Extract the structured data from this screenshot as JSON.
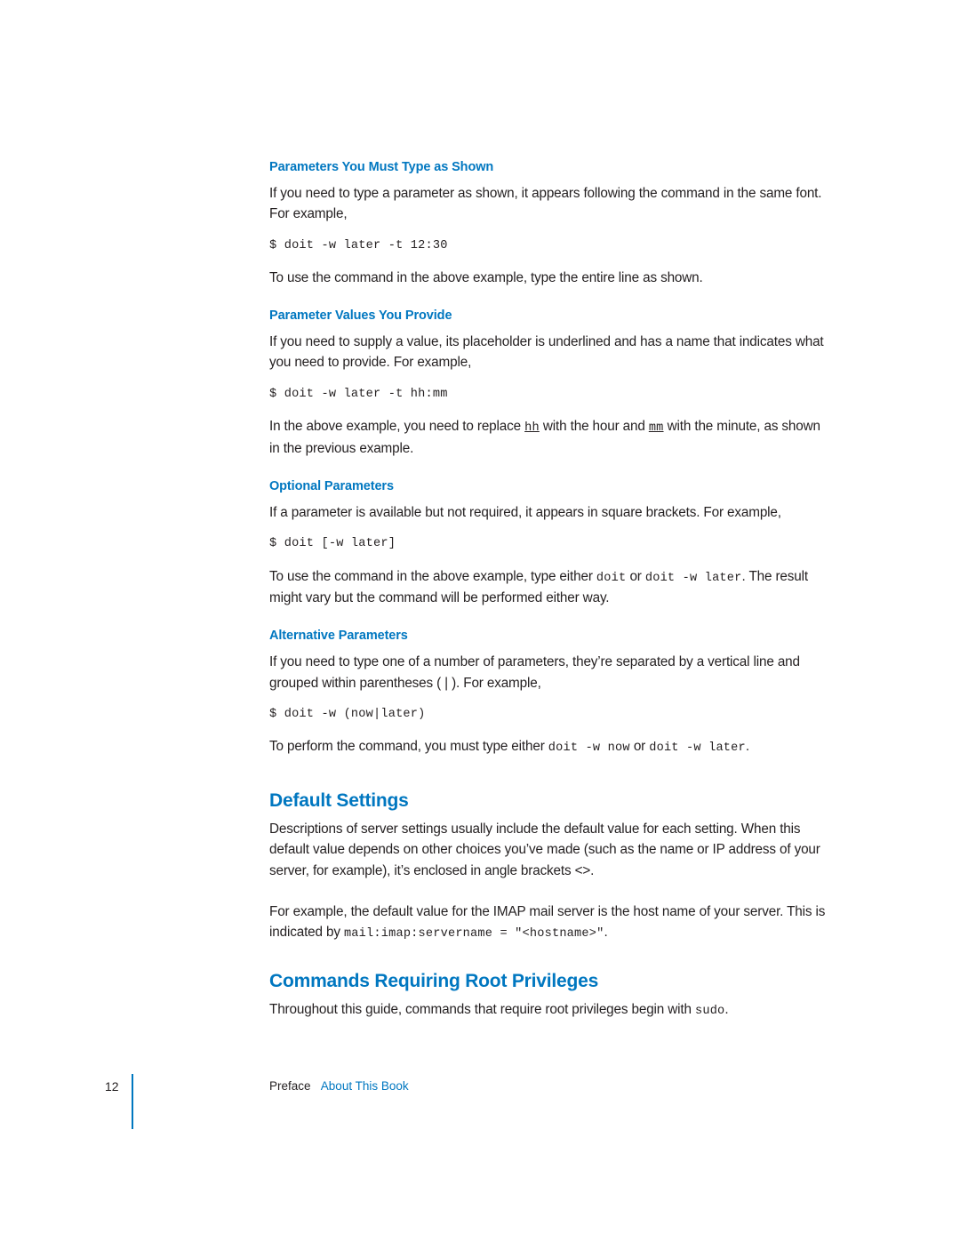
{
  "document": {
    "sections": [
      {
        "heading": "Parameters You Must Type as Shown",
        "paragraphs": [
          "If you need to type a parameter as shown, it appears following the command in the same font. For example,"
        ],
        "code": "$ doit -w later -t 12:30",
        "after": "To use the command in the above example, type the entire line as shown."
      },
      {
        "heading": "Parameter Values You Provide",
        "paragraphs": [
          "If you need to supply a value, its placeholder is underlined and has a name that indicates what you need to provide. For example,"
        ],
        "code": "$ doit -w later -t hh:mm",
        "after_parts": {
          "t1": "In the above example, you need to replace ",
          "c1": "hh",
          "t2": " with the hour and ",
          "c2": "mm",
          "t3": " with the minute, as shown in the previous example."
        }
      },
      {
        "heading": "Optional Parameters",
        "paragraphs": [
          "If a parameter is available but not required, it appears in square brackets. For example,"
        ],
        "code": "$ doit [-w later]",
        "after_parts": {
          "t1": "To use the command in the above example, type either ",
          "c1": "doit",
          "t2": " or ",
          "c2": "doit -w later",
          "t3": ". The result might vary but the command will be performed either way."
        }
      },
      {
        "heading": "Alternative Parameters",
        "paragraphs": [
          "If you need to type one of a number of parameters, they’re separated by a vertical line and grouped within parentheses ( | ). For example,"
        ],
        "code": "$ doit -w (now|later)",
        "after_parts": {
          "t1": "To perform the command, you must type either ",
          "c1": "doit -w now",
          "t2": " or ",
          "c2": "doit -w later",
          "t3": "."
        }
      }
    ],
    "default_settings": {
      "heading": "Default Settings",
      "p1": "Descriptions of server settings usually include the default value for each setting. When this default value depends on other choices you’ve made (such as the name or IP address of your server, for example), it’s enclosed in angle brackets <>.",
      "p2_t1": "For example, the default value for the IMAP mail server is the host name of your server. This is indicated by ",
      "p2_c1": "mail:imap:servername = \"<hostname>\"",
      "p2_t2": "."
    },
    "root_privileges": {
      "heading": "Commands Requiring Root Privileges",
      "p1_t1": "Throughout this guide, commands that require root privileges begin with ",
      "p1_c1": "sudo",
      "p1_t2": "."
    },
    "footer": {
      "page_number": "12",
      "label": "Preface",
      "separator": "   ",
      "link": "About This Book"
    },
    "colors": {
      "accent": "#0077c0",
      "text": "#231f20"
    }
  }
}
